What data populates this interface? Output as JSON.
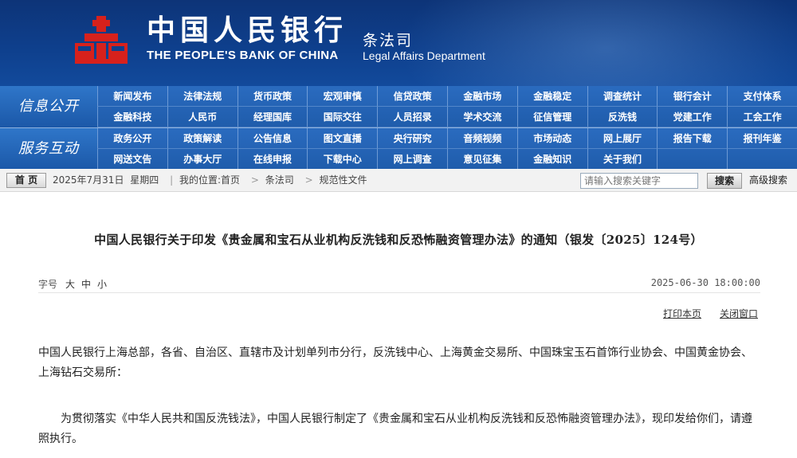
{
  "header": {
    "bank_name_cn": "中国人民银行",
    "bank_name_en": "THE PEOPLE'S BANK OF CHINA",
    "dept_name_cn": "条法司",
    "dept_name_en": "Legal Affairs Department",
    "logo_color": "#d7211c"
  },
  "nav": {
    "row1_label": "信息公开",
    "row1_items": [
      "新闻发布",
      "法律法规",
      "货币政策",
      "宏观审慎",
      "信贷政策",
      "金融市场",
      "金融稳定",
      "调查统计",
      "银行会计",
      "支付体系",
      "金融科技",
      "人民币",
      "经理国库",
      "国际交往",
      "人员招录",
      "学术交流",
      "征信管理",
      "反洗钱",
      "党建工作",
      "工会工作"
    ],
    "row2_label": "服务互动",
    "row2_items": [
      "政务公开",
      "政策解读",
      "公告信息",
      "图文直播",
      "央行研究",
      "音频视频",
      "市场动态",
      "网上展厅",
      "报告下载",
      "报刊年鉴",
      "网送文告",
      "办事大厅",
      "在线申报",
      "下载中心",
      "网上调查",
      "意见征集",
      "金融知识",
      "关于我们",
      "",
      ""
    ]
  },
  "breadcrumb": {
    "home_label": "首 页",
    "date": "2025年7月31日",
    "weekday": "星期四",
    "location_label": "我的位置:首页",
    "crumb2": "条法司",
    "crumb3": "规范性文件",
    "search_placeholder": "请输入搜索关键字",
    "search_button": "搜索",
    "advanced_search": "高级搜索"
  },
  "article": {
    "title": "中国人民银行关于印发《贵金属和宝石从业机构反洗钱和反恐怖融资管理办法》的通知（银发〔2025〕124号）",
    "font_size_label": "字号",
    "font_large": "大",
    "font_medium": "中",
    "font_small": "小",
    "pub_datetime": "2025-06-30 18:00:00",
    "print_label": "打印本页",
    "close_label": "关闭窗口",
    "paragraph1": "中国人民银行上海总部，各省、自治区、直辖市及计划单列市分行，反洗钱中心、上海黄金交易所、中国珠宝玉石首饰行业协会、中国黄金协会、上海钻石交易所：",
    "paragraph2": "为贯彻落实《中华人民共和国反洗钱法》，中国人民银行制定了《贵金属和宝石从业机构反洗钱和反恐怖融资管理办法》，现印发给你们，请遵照执行。"
  }
}
